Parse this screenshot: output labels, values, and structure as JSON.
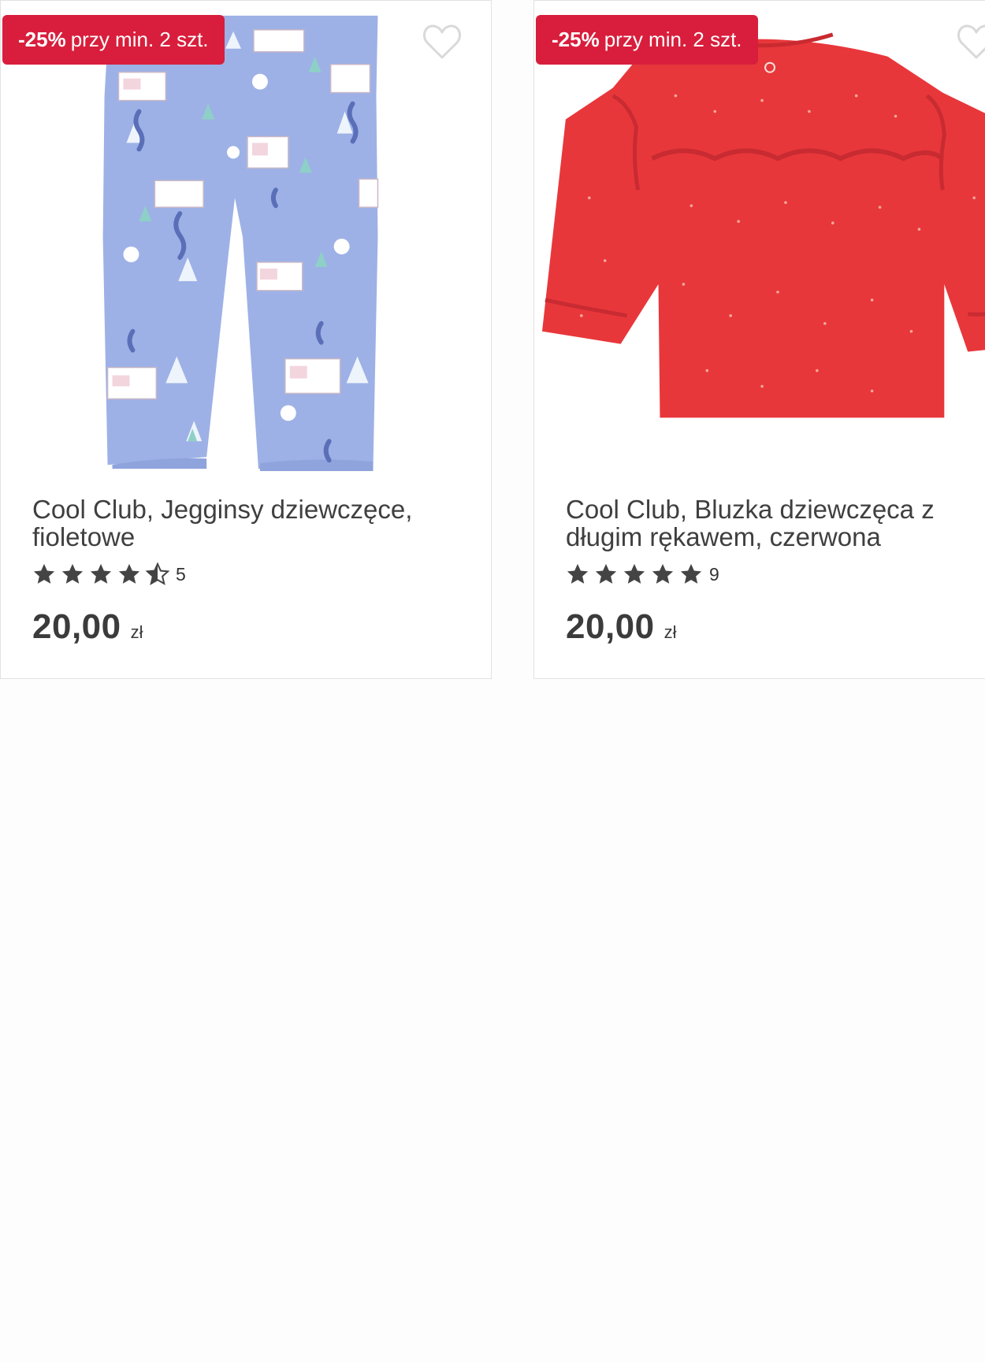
{
  "products": [
    {
      "promo": {
        "percent": "-25%",
        "text": "przy min. 2 szt."
      },
      "title": "Cool Club, Jegginsy dziewczęce, fioletowe",
      "rating": {
        "stars": 4.5,
        "count": "5"
      },
      "price": {
        "value": "20,00",
        "currency": "zł"
      },
      "image": "purple-leggings-with-house-print",
      "colors": {
        "image_main": "#9db1e6",
        "badge": "#d81e3c"
      }
    },
    {
      "promo": {
        "percent": "-25%",
        "text": "przy min. 2 szt."
      },
      "title": "Cool Club, Bluzka dziewczęca z długim rękawem, czerwona",
      "rating": {
        "stars": 5,
        "count": "9"
      },
      "price": {
        "value": "20,00",
        "currency": "zł"
      },
      "image": "red-long-sleeve-blouse-with-dots",
      "colors": {
        "image_main": "#e8373b",
        "badge": "#d81e3c"
      }
    }
  ],
  "icons": {
    "favorite": "heart-outline-icon",
    "rating": "star-icon"
  }
}
